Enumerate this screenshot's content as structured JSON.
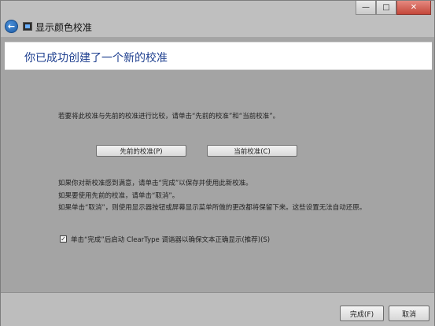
{
  "window": {
    "title": "显示颜色校准",
    "caption": {
      "minimize": "—",
      "maximize": "□",
      "close": "✕"
    }
  },
  "header": {
    "title": "你已成功创建了一个新的校准"
  },
  "content": {
    "compare_text": "若要将此校准与先前的校准进行比较，请单击“先前的校准”和“当前校准”。",
    "previous_button": "先前的校准(P)",
    "current_button": "当前校准(C)",
    "line1": "如果你对新校准感到满意，请单击“完成”以保存并使用此新校准。",
    "line2": "如果要使用先前的校准，请单击“取消”。",
    "line3": "如果单击“取消”，则使用显示器按钮或屏幕显示菜单所做的更改都将保留下来。这些设置无法自动还原。",
    "checkbox_checked": true,
    "checkbox_mark": "✓",
    "checkbox_label": "单击“完成”后启动 ClearType 调谐器以确保文本正确显示(推荐)(S)"
  },
  "footer": {
    "finish_button": "完成(F)",
    "cancel_button": "取消"
  }
}
